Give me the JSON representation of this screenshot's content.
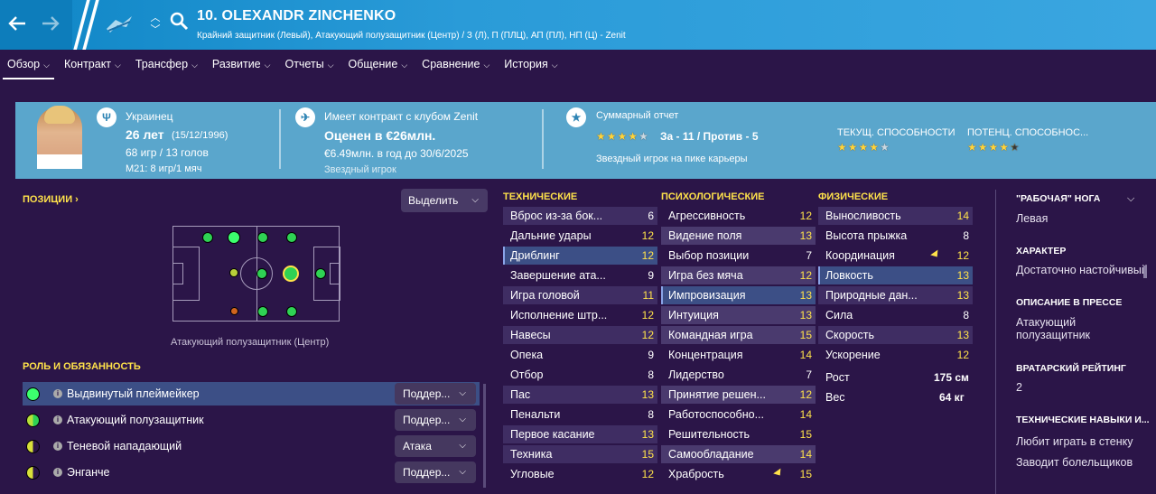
{
  "header": {
    "player_name": "10. OLEXANDR ZINCHENKO",
    "subtitle": "Крайний защитник (Левый), Атакующий полузащитник (Центр) / З (Л), П (ПЛЦ), АП (ПЛ), НП (Ц) - Zenit",
    "back_icon": "arrow-left",
    "forward_icon": "arrow-right",
    "search_icon": "search",
    "accent_color": "#1d8fcf"
  },
  "tabs": [
    {
      "label": "Обзор",
      "active": true
    },
    {
      "label": "Контракт"
    },
    {
      "label": "Трансфер"
    },
    {
      "label": "Развитие"
    },
    {
      "label": "Отчеты"
    },
    {
      "label": "Общение"
    },
    {
      "label": "Сравнение"
    },
    {
      "label": "История"
    }
  ],
  "banner": {
    "nationality": "Украинец",
    "age": "26 лет",
    "birth_date": "(15/12/1996)",
    "apps": "68 игр / 13 голов",
    "u21": "М21: 8 игр/1 мяч",
    "contract": "Имеет контракт с клубом Zenit",
    "value": "Оценен в €26млн.",
    "wage": "€6.49млн. в год до 30/6/2025",
    "contract_extra": "Звездный игрок",
    "report_title": "Суммарный отчет",
    "report_score": "За - 11 / Против - 5",
    "report_rating": 4,
    "report_desc": "Звездный игрок на пике карьеры",
    "current_ability_label": "ТЕКУЩ. СПОСОБНОСТИ",
    "current_ability_stars": 4,
    "potential_ability_label": "ПОТЕНЦ. СПОСОБНОС...",
    "potential_ability_stars": 4.5
  },
  "positions": {
    "title": "ПОЗИЦИИ",
    "highlight_button": "Выделить",
    "label": "Атакующий полузащитник (Центр)"
  },
  "roles": {
    "title": "РОЛЬ И ОБЯЗАННОСТЬ",
    "items": [
      {
        "name": "Выдвинутый плеймейкер",
        "duty": "Поддер...",
        "selected": true
      },
      {
        "name": "Атакующий полузащитник",
        "duty": "Поддер..."
      },
      {
        "name": "Теневой нападающий",
        "duty": "Атака"
      },
      {
        "name": "Энганче",
        "duty": "Поддер..."
      }
    ]
  },
  "attributes": {
    "technical": {
      "title": "ТЕХНИЧЕСКИЕ",
      "items": [
        {
          "name": "Вброс из-за бок...",
          "value": "6"
        },
        {
          "name": "Дальние удары",
          "value": "12"
        },
        {
          "name": "Дриблинг",
          "value": "12"
        },
        {
          "name": "Завершение ата...",
          "value": "9"
        },
        {
          "name": "Игра головой",
          "value": "11"
        },
        {
          "name": "Исполнение штр...",
          "value": "12"
        },
        {
          "name": "Навесы",
          "value": "12"
        },
        {
          "name": "Опека",
          "value": "9"
        },
        {
          "name": "Отбор",
          "value": "8"
        },
        {
          "name": "Пас",
          "value": "13"
        },
        {
          "name": "Пенальти",
          "value": "8"
        },
        {
          "name": "Первое касание",
          "value": "13"
        },
        {
          "name": "Техника",
          "value": "15"
        },
        {
          "name": "Угловые",
          "value": "12"
        }
      ]
    },
    "mental": {
      "title": "ПСИХОЛОГИЧЕСКИЕ",
      "items": [
        {
          "name": "Агрессивность",
          "value": "12"
        },
        {
          "name": "Видение поля",
          "value": "13"
        },
        {
          "name": "Выбор позиции",
          "value": "7"
        },
        {
          "name": "Игра без мяча",
          "value": "12"
        },
        {
          "name": "Импровизация",
          "value": "13"
        },
        {
          "name": "Интуиция",
          "value": "13"
        },
        {
          "name": "Командная игра",
          "value": "15"
        },
        {
          "name": "Концентрация",
          "value": "14"
        },
        {
          "name": "Лидерство",
          "value": "7"
        },
        {
          "name": "Принятие решен...",
          "value": "12"
        },
        {
          "name": "Работоспособно...",
          "value": "14"
        },
        {
          "name": "Решительность",
          "value": "15"
        },
        {
          "name": "Самообладание",
          "value": "14"
        },
        {
          "name": "Храбрость",
          "value": "15"
        }
      ]
    },
    "physical": {
      "title": "ФИЗИЧЕСКИЕ",
      "items": [
        {
          "name": "Выносливость",
          "value": "14"
        },
        {
          "name": "Высота прыжка",
          "value": "8"
        },
        {
          "name": "Координация",
          "value": "12"
        },
        {
          "name": "Ловкость",
          "value": "13"
        },
        {
          "name": "Природные дан...",
          "value": "13"
        },
        {
          "name": "Сила",
          "value": "8"
        },
        {
          "name": "Скорость",
          "value": "13"
        },
        {
          "name": "Ускорение",
          "value": "12"
        }
      ],
      "height_label": "Рост",
      "height_value": "175 см",
      "weight_label": "Вес",
      "weight_value": "64 кг"
    }
  },
  "info": {
    "foot_title": "\"РАБОЧАЯ\" НОГА",
    "foot_value": "Левая",
    "character_title": "ХАРАКТЕР",
    "character_value": "Достаточно настойчивый",
    "press_title": "ОПИСАНИЕ В ПРЕССЕ",
    "press_value_1": "Атакующий",
    "press_value_2": "полузащитник",
    "gk_title": "ВРАТАРСКИЙ РЕЙТИНГ",
    "gk_value": "2",
    "skills_title": "ТЕХНИЧЕСКИЕ НАВЫКИ И...",
    "skill_1": "Любит играть в стенку",
    "skill_2": "Заводит болельщиков"
  }
}
